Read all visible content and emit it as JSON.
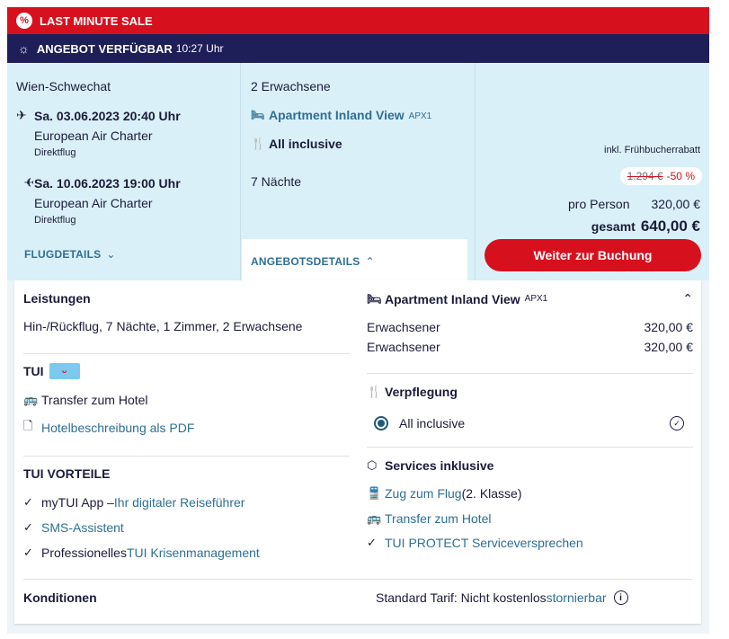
{
  "sale": {
    "label": "LAST MINUTE SALE",
    "icon": "percent-icon"
  },
  "offer": {
    "title": "ANGEBOT VERFÜGBAR",
    "time": "10:27 Uhr",
    "icon": "sun-icon"
  },
  "flights": {
    "departure_airport": "Wien-Schwechat",
    "outbound": {
      "datetime": "Sa. 03.06.2023 20:40 Uhr",
      "airline": "European Air Charter",
      "type": "Direktflug"
    },
    "inbound": {
      "datetime": "Sa. 10.06.2023 19:00 Uhr",
      "airline": "European Air Charter",
      "type": "Direktflug"
    },
    "details_tab": "FLUGDETAILS"
  },
  "accommodation": {
    "travellers": "2 Erwachsene",
    "room": "Apartment Inland View",
    "room_code": "APX1",
    "board": "All inclusive",
    "nights": "7 Nächte",
    "details_tab": "ANGEBOTSDETAILS"
  },
  "price": {
    "note": "inkl. Frühbucherrabatt",
    "old_price": "1.294 €",
    "discount": "-50 %",
    "per_person_label": "pro Person",
    "per_person": "320,00 €",
    "total_label": "gesamt",
    "total": "640,00 €",
    "book_button": "Weiter zur Buchung"
  },
  "details": {
    "services_heading": "Leistungen",
    "services_text": "Hin-/Rückflug, 7 Nächte, 1 Zimmer, 2 Erwachsene",
    "tui_heading": "TUI",
    "tui_logo": "tui-smile-logo",
    "transfer": "Transfer zum Hotel",
    "pdf_link": "Hotelbeschreibung als PDF",
    "advantages_heading": "TUI VORTEILE",
    "adv1_a": "myTUI App – ",
    "adv1_b": "Ihr digitaler Reiseführer",
    "adv2": "SMS-Assistent",
    "adv3_a": "Professionelles ",
    "adv3_b": "TUI Krisenmanagement",
    "conditions_heading": "Konditionen",
    "room_heading": "Apartment Inland View",
    "room_code": "APX1",
    "adult1_label": "Erwachsener",
    "adult1_price": "320,00 €",
    "adult2_label": "Erwachsener",
    "adult2_price": "320,00 €",
    "catering_heading": "Verpflegung",
    "catering_option": "All inclusive",
    "included_heading": "Services inklusive",
    "train_a": "Zug zum Flug",
    "train_b": " (2. Klasse)",
    "transfer2": "Transfer zum Hotel",
    "protect": "TUI PROTECT Serviceversprechen",
    "tariff_a": "Standard Tarif: Nicht kostenlos ",
    "tariff_b": "stornierbar"
  },
  "colors": {
    "sale_red": "#d7101e",
    "navy": "#1e1e58",
    "light_blue": "#daf0f9",
    "link_blue": "#2e6f93"
  }
}
